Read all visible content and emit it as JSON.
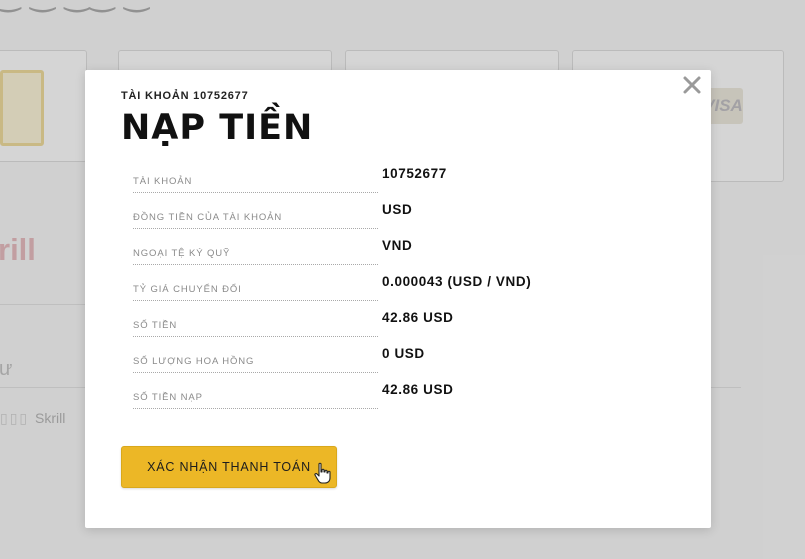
{
  "background": {
    "visa_logo_text": "VISA",
    "skrill_logo_text": "rill",
    "skrill_row_label": "Skrill",
    "corner_glyph": "ư"
  },
  "modal": {
    "account_heading": "TÀI KHOẢN 10752677",
    "title": "NẠP TIỀN",
    "close_icon": "close-icon",
    "rows": [
      {
        "label": "TÀI KHOẢN",
        "value": "10752677"
      },
      {
        "label": "ĐỒNG TIỀN CỦA TÀI KHOẢN",
        "value": "USD"
      },
      {
        "label": "NGOẠI TỆ KÝ QUỸ",
        "value": "VND"
      },
      {
        "label": "TỶ GIÁ CHUYỂN ĐỔI",
        "value": "0.000043 (USD / VND)"
      },
      {
        "label": "SỐ TIỀN",
        "value": "42.86 USD"
      },
      {
        "label": "SỐ LƯỢNG HOA HỒNG",
        "value": "0 USD"
      },
      {
        "label": "SỐ TIỀN NẠP",
        "value": "42.86 USD"
      }
    ],
    "confirm_button_label": "XÁC NHẬN THANH TOÁN"
  },
  "colors": {
    "accent": "#ecb726",
    "overlay": "rgba(120,120,120,0.28)"
  }
}
